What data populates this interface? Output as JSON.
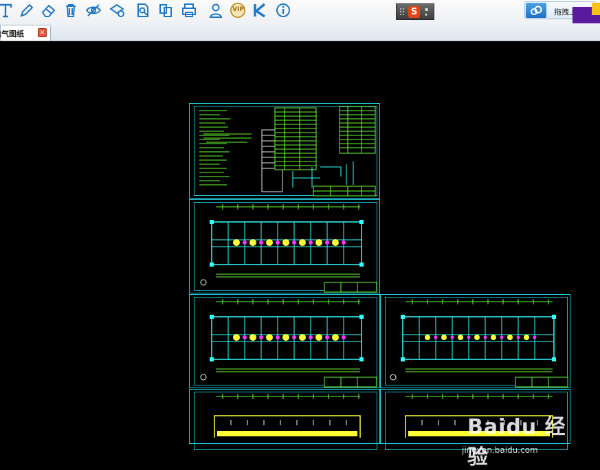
{
  "toolbar": {
    "icons": [
      "text-icon",
      "pencil-icon",
      "eraser-icon",
      "trash-icon",
      "eye-hide-icon",
      "layer-settings-icon",
      "zoom-page-icon",
      "copy-pages-icon",
      "print-icon",
      "user-icon",
      "vip-icon",
      "k-logo-icon",
      "info-icon"
    ],
    "vip_label": "VIP",
    "accent": "#1e78c8"
  },
  "ime": {
    "logo": "S",
    "menu": "▪\n▾"
  },
  "upload": {
    "label": "拖拽上传"
  },
  "tabs": [
    {
      "label": "电气图纸",
      "close": "×"
    }
  ],
  "watermark": {
    "text": "Baidu 经验",
    "sub": "jingyan.baidu.com"
  },
  "colors": {
    "sheet_border": "#22d3e6",
    "cad_green": "#66ff33",
    "cad_yellow": "#ffff33",
    "cad_magenta": "#ff33ff",
    "cad_cyan": "#33ffff"
  }
}
